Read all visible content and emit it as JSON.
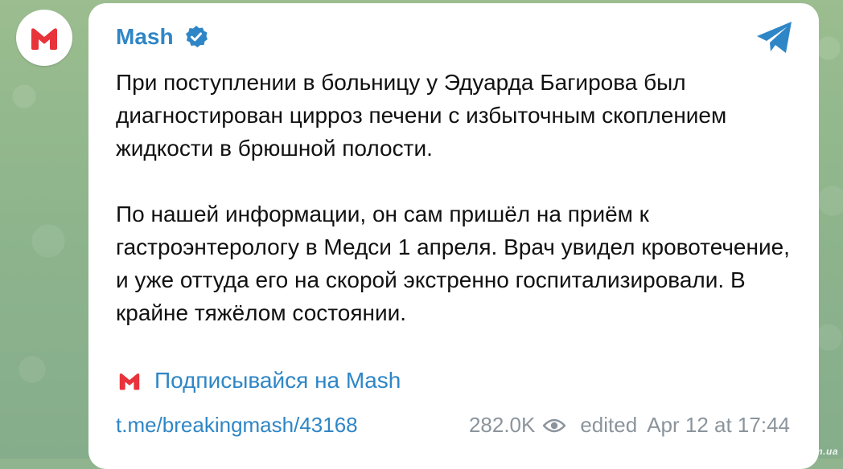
{
  "channel": {
    "name": "Mash",
    "verified": true,
    "avatar_icon": "mash-logo-icon",
    "brand_color": "#e8333b"
  },
  "post": {
    "paragraphs": [
      "При поступлении в больницу у Эдуарда Багирова был диагностирован цирроз печени с избыточным скоплением жидкости в брюшной полости.",
      "По нашей информации, он сам пришёл на приём к гастроэнтерологу в Медси 1 апреля. Врач увидел кровотечение, и уже оттуда его на скорой экстренно госпитализировали. В крайне тяжёлом состоянии."
    ],
    "subscribe_label": "Подписывайся на Mash",
    "link": "t.me/breakingmash/43168",
    "views": "282.0K",
    "edited_label": "edited",
    "date": "Apr 12 at 17:44"
  },
  "watermark": "nevsedoma.com.ua",
  "colors": {
    "accent": "#2f86c6",
    "background": "#8fb48e",
    "meta": "#8b949c"
  }
}
